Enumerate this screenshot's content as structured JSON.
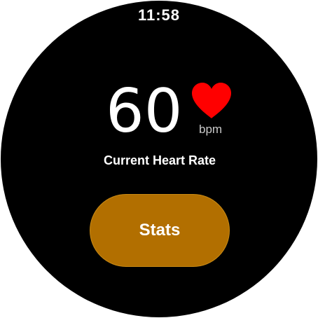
{
  "status": {
    "time": "11:58"
  },
  "heart_rate": {
    "value": "60",
    "unit": "bpm",
    "caption": "Current Heart Rate",
    "icon": "heart-icon",
    "icon_color": "#ff0000"
  },
  "actions": {
    "stats_label": "Stats",
    "stats_color": "#b26f00"
  }
}
